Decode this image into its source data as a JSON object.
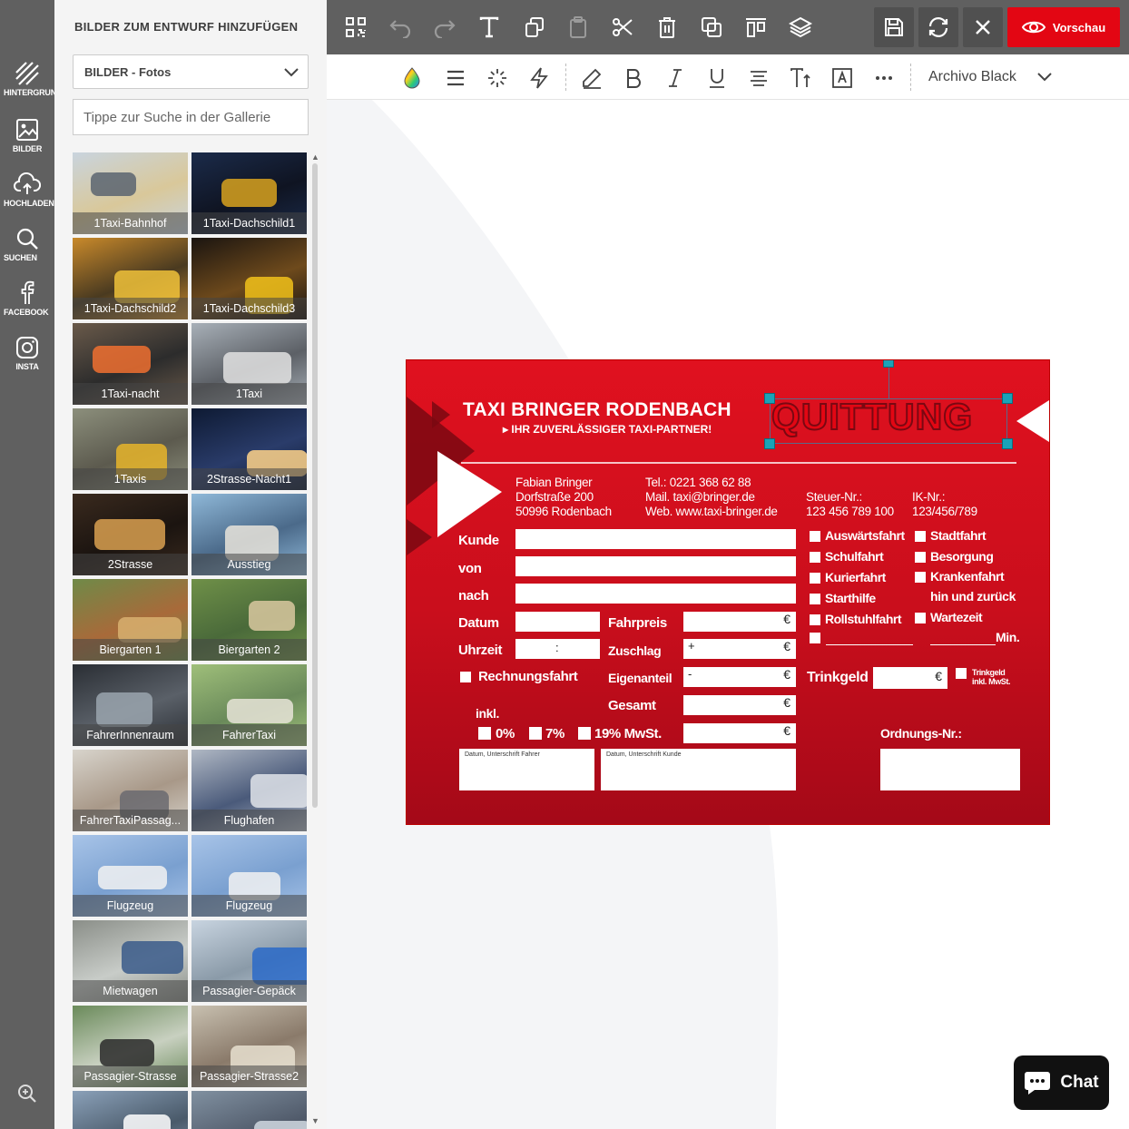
{
  "rail": {
    "items": [
      {
        "label": "HINTERGRUND",
        "icon": "stripes-icon"
      },
      {
        "label": "BILDER",
        "icon": "image-icon"
      },
      {
        "label": "HOCHLADEN",
        "icon": "upload-cloud-icon"
      },
      {
        "label": "SUCHEN",
        "icon": "search-icon"
      },
      {
        "label": "FACEBOOK",
        "icon": "facebook-icon"
      },
      {
        "label": "INSTA",
        "icon": "instagram-icon"
      }
    ],
    "zoom_icon": "zoom-in-icon"
  },
  "panel": {
    "title": "BILDER ZUM ENTWURF HINZUFÜGEN",
    "category": "BILDER - Fotos",
    "search_placeholder": "Tippe zur Suche in der Gallerie",
    "thumbnails": [
      {
        "label": "1Taxi-Bahnhof"
      },
      {
        "label": "1Taxi-Dachschild1"
      },
      {
        "label": "1Taxi-Dachschild2"
      },
      {
        "label": "1Taxi-Dachschild3"
      },
      {
        "label": "1Taxi-nacht"
      },
      {
        "label": "1Taxi"
      },
      {
        "label": "1Taxis"
      },
      {
        "label": "2Strasse-Nacht1"
      },
      {
        "label": "2Strasse"
      },
      {
        "label": "Ausstieg"
      },
      {
        "label": "Biergarten 1"
      },
      {
        "label": "Biergarten 2"
      },
      {
        "label": "FahrerInnenraum"
      },
      {
        "label": "FahrerTaxi"
      },
      {
        "label": "FahrerTaxiPassag..."
      },
      {
        "label": "Flughafen"
      },
      {
        "label": "Flugzeug"
      },
      {
        "label": "Flugzeug"
      },
      {
        "label": "Mietwagen"
      },
      {
        "label": "Passagier-Gepäck"
      },
      {
        "label": "Passagier-Strasse"
      },
      {
        "label": "Passagier-Strasse2"
      },
      {
        "label": ""
      },
      {
        "label": ""
      }
    ]
  },
  "toolbar": {
    "icons": [
      "qr-code-icon",
      "undo-icon",
      "redo-icon",
      "text-icon",
      "copy-style-icon",
      "paste-icon",
      "cut-icon",
      "delete-icon",
      "duplicate-icon",
      "align-icon",
      "layers-icon"
    ],
    "save_icon": "save-icon",
    "refresh_icon": "refresh-icon",
    "close_icon": "close-icon",
    "preview_label": "Vorschau"
  },
  "format_bar": {
    "icons": [
      "color-drop-icon",
      "line-height-icon",
      "effects-icon",
      "flash-icon",
      "pen-icon",
      "bold-icon",
      "italic-icon",
      "underline-icon",
      "text-align-icon",
      "font-size-icon",
      "text-box-icon",
      "more-icon"
    ],
    "font_name": "Archivo Black"
  },
  "receipt": {
    "company": "TAXI BRINGER RODENBACH",
    "slogan": "IHR ZUVERLÄSSIGER TAXI-PARTNER!",
    "title": "QUITTUNG",
    "address": [
      "Fabian Bringer",
      "Dorfstraße 200",
      "50996 Rodenbach"
    ],
    "contact": [
      "Tel.: 0221 368 62 88",
      "Mail. taxi@bringer.de",
      "Web. www.taxi-bringer.de"
    ],
    "tax_label": "Steuer-Nr.:",
    "tax_value": "123 456 789 100",
    "ik_label": "IK-Nr.:",
    "ik_value": "123/456/789",
    "labels": {
      "kunde": "Kunde",
      "von": "von",
      "nach": "nach",
      "datum": "Datum",
      "uhrzeit": "Uhrzeit",
      "fahrpreis": "Fahrpreis",
      "zuschlag": "Zuschlag",
      "eigenanteil": "Eigenanteil",
      "gesamt": "Gesamt",
      "rechnungsfahrt": "Rechnungsfahrt",
      "inkl": "inkl.",
      "vat0": "0%",
      "vat7": "7%",
      "vat19": "19% MwSt.",
      "trinkgeld": "Trinkgeld",
      "trinkgeld_note": "Trinkgeld inkl. MwSt.",
      "ordnungs": "Ordnungs-Nr.:",
      "sig_driver": "Datum, Unterschrift Fahrer",
      "sig_customer": "Datum, Unterschrift Kunde",
      "min": "Min.",
      "hin_zurueck": "hin und zurück"
    },
    "time_sep": ":",
    "euro": "€",
    "plus": "+",
    "minus": "-",
    "trip_types_left": [
      "Auswärtsfahrt",
      "Schulfahrt",
      "Kurierfahrt",
      "Starthilfe",
      "Rollstuhlfahrt"
    ],
    "trip_types_right": [
      "Stadtfahrt",
      "Besorgung",
      "Krankenfahrt",
      "Wartezeit"
    ]
  },
  "chat": {
    "label": "Chat",
    "icon": "chat-bubble-icon"
  }
}
